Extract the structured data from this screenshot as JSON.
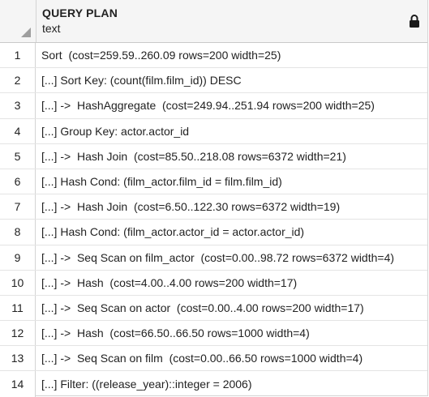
{
  "column": {
    "name": "QUERY PLAN",
    "type": "text"
  },
  "rows": [
    {
      "num": "1",
      "text": "Sort  (cost=259.59..260.09 rows=200 width=25)"
    },
    {
      "num": "2",
      "text": "[...] Sort Key: (count(film.film_id)) DESC"
    },
    {
      "num": "3",
      "text": "[...] ->  HashAggregate  (cost=249.94..251.94 rows=200 width=25)"
    },
    {
      "num": "4",
      "text": "[...] Group Key: actor.actor_id"
    },
    {
      "num": "5",
      "text": "[...] ->  Hash Join  (cost=85.50..218.08 rows=6372 width=21)"
    },
    {
      "num": "6",
      "text": "[...] Hash Cond: (film_actor.film_id = film.film_id)"
    },
    {
      "num": "7",
      "text": "[...] ->  Hash Join  (cost=6.50..122.30 rows=6372 width=19)"
    },
    {
      "num": "8",
      "text": "[...] Hash Cond: (film_actor.actor_id = actor.actor_id)"
    },
    {
      "num": "9",
      "text": "[...] ->  Seq Scan on film_actor  (cost=0.00..98.72 rows=6372 width=4)"
    },
    {
      "num": "10",
      "text": "[...] ->  Hash  (cost=4.00..4.00 rows=200 width=17)"
    },
    {
      "num": "11",
      "text": "[...] ->  Seq Scan on actor  (cost=0.00..4.00 rows=200 width=17)"
    },
    {
      "num": "12",
      "text": "[...] ->  Hash  (cost=66.50..66.50 rows=1000 width=4)"
    },
    {
      "num": "13",
      "text": "[...] ->  Seq Scan on film  (cost=0.00..66.50 rows=1000 width=4)"
    },
    {
      "num": "14",
      "text": "[...] Filter: ((release_year)::integer = 2006)"
    }
  ]
}
